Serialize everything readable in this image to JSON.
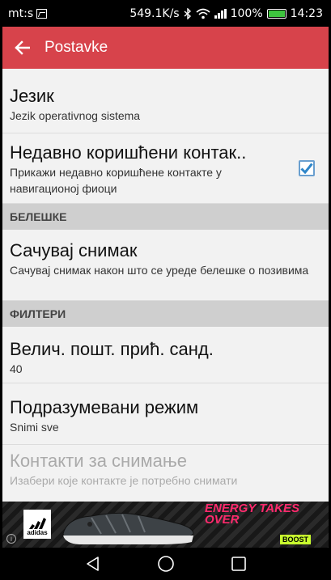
{
  "status_bar": {
    "carrier": "mt:s",
    "speed": "549.1K/s",
    "battery_percent": "100%",
    "time": "14:23",
    "icons": [
      "gallery-icon",
      "bluetooth-icon",
      "wifi-icon",
      "signal-icon",
      "battery-icon"
    ]
  },
  "app_bar": {
    "title": "Postavke",
    "background": "#d7434b",
    "back_icon": "arrow-left-icon"
  },
  "preferences": {
    "language": {
      "title": "Језик",
      "summary": "Jezik operativnog sistema"
    },
    "recent_contacts": {
      "title": "Недавно коришћени контак..",
      "summary": "Прикажи недавно коришћене контакте у навигационој фиоци",
      "checked": true
    },
    "notes_header": "БЕЛЕШКЕ",
    "save_recording": {
      "title": "Сачувај снимак",
      "summary": "Сачувај снимак након што се уреде белешке о позивима"
    },
    "filters_header": "ФИЛТЕРИ",
    "max_size": {
      "title": "Велич. пошт. прић. санд.",
      "summary": "40"
    },
    "default_mode": {
      "title": "Подразумевани режим",
      "summary": "Snimi sve"
    },
    "contacts_to_record": {
      "title": "Контакти за снимање",
      "summary": "Изабери које контакте је потребно снимати",
      "enabled": false
    }
  },
  "ad": {
    "brand": "adidas",
    "slogan": "ENERGY TAKES OVER",
    "tag": "BOOST",
    "info_icon": "info-icon"
  },
  "nav_bar": {
    "icons": [
      "back-triangle-icon",
      "home-circle-icon",
      "recents-square-icon"
    ]
  }
}
